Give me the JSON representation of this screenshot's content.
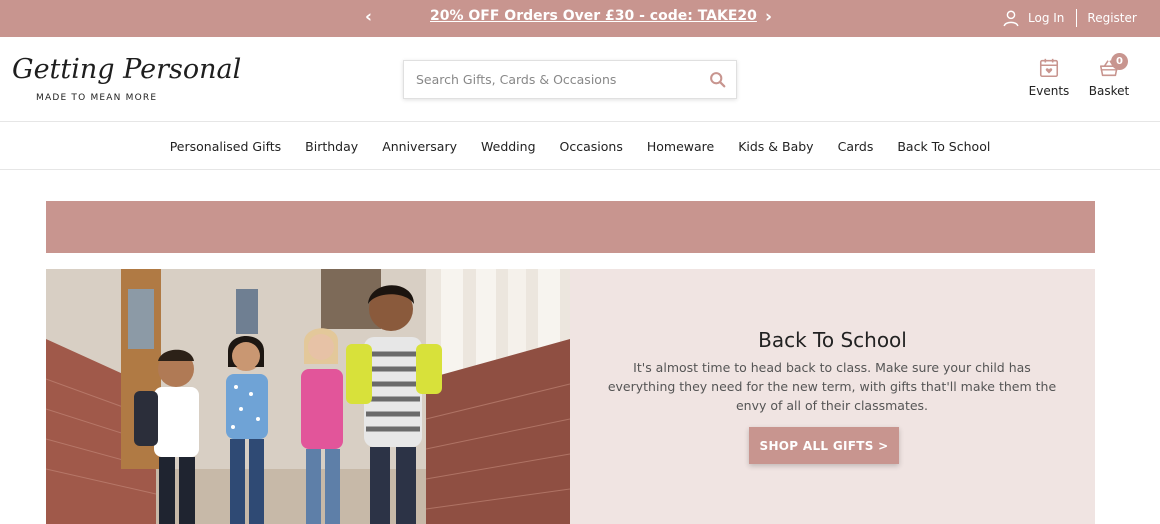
{
  "promo": {
    "text": "20% OFF Orders Over £30 - code: TAKE20",
    "prev_arrow": "‹",
    "next_arrow": "›",
    "login": "Log In",
    "register": "Register"
  },
  "logo": {
    "name": "Getting Personal",
    "tagline": "MADE TO MEAN MORE"
  },
  "search": {
    "placeholder": "Search Gifts, Cards & Occasions",
    "value": ""
  },
  "header_actions": {
    "events_label": "Events",
    "basket_label": "Basket",
    "basket_count": "0"
  },
  "nav": {
    "items": [
      "Personalised Gifts",
      "Birthday",
      "Anniversary",
      "Wedding",
      "Occasions",
      "Homeware",
      "Kids & Baby",
      "Cards",
      "Back To School"
    ]
  },
  "hero": {
    "title": "Back To School",
    "description": "It's almost time to head back to class. Make sure your child has everything they need for the new term, with gifts that'll make them the envy of all of their classmates.",
    "button": "SHOP ALL GIFTS >"
  },
  "colors": {
    "accent": "#c8958f",
    "hero_bg": "#f0e4e2",
    "text": "#222222"
  },
  "icons": [
    "chevron-left-icon",
    "chevron-right-icon",
    "user-icon",
    "search-icon",
    "calendar-heart-icon",
    "basket-icon"
  ]
}
